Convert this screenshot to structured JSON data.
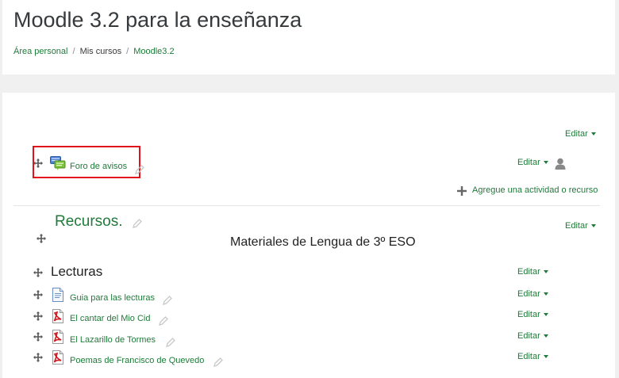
{
  "header": {
    "title": "Moodle 3.2 para la enseñanza",
    "breadcrumb": {
      "item1": "Área personal",
      "item2": "Mis cursos",
      "item3": "Moodle3.2",
      "separator": "/"
    }
  },
  "section0": {
    "edit_label": "Editar",
    "activity": {
      "label": "Foro de avisos",
      "edit_label": "Editar"
    },
    "add_activity_label": "Agregue una actividad o recurso"
  },
  "section1": {
    "title": "Recursos.",
    "edit_label": "Editar",
    "summary": "Materiales de Lengua de 3º ESO",
    "label_lecturas": "Lecturas",
    "label_lecturas_edit": "Editar",
    "resources": [
      {
        "label": "Guia para las lecturas",
        "edit_label": "Editar",
        "icon": "document-icon"
      },
      {
        "label": "El cantar del Mio Cid",
        "edit_label": "Editar",
        "icon": "pdf-icon"
      },
      {
        "label": "El Lazarillo de Tormes",
        "edit_label": "Editar",
        "icon": "pdf-icon"
      },
      {
        "label": "Poemas de Francisco de Quevedo",
        "edit_label": "Editar",
        "icon": "pdf-icon"
      }
    ]
  },
  "colors": {
    "link": "#1f7b3a",
    "highlight": "#e0121b",
    "background": "#f0f0f0"
  }
}
